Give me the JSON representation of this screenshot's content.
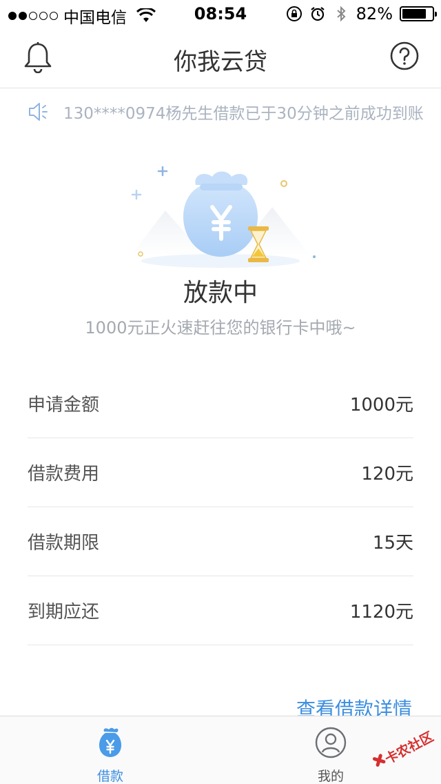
{
  "status_bar": {
    "carrier": "中国电信",
    "time": "08:54",
    "battery": "82%"
  },
  "nav": {
    "title": "你我云贷",
    "left_icon": "bell-icon",
    "right_icon": "help-icon"
  },
  "notice": {
    "text": "130****0974杨先生借款已于30分钟之前成功到账"
  },
  "status": {
    "title": "放款中",
    "subtitle": "1000元正火速赶往您的银行卡中哦~"
  },
  "details": [
    {
      "label": "申请金额",
      "value": "1000元"
    },
    {
      "label": "借款费用",
      "value": "120元"
    },
    {
      "label": "借款期限",
      "value": "15天"
    },
    {
      "label": "到期应还",
      "value": "1120元"
    }
  ],
  "view_detail_link": "查看借款详情",
  "tabs": [
    {
      "label": "借款",
      "active": true,
      "icon": "money-bag-icon"
    },
    {
      "label": "我的",
      "active": false,
      "icon": "user-icon"
    }
  ],
  "watermark": "卡农社区",
  "colors": {
    "accent": "#3c8ee0",
    "muted": "#a4a9b0"
  }
}
